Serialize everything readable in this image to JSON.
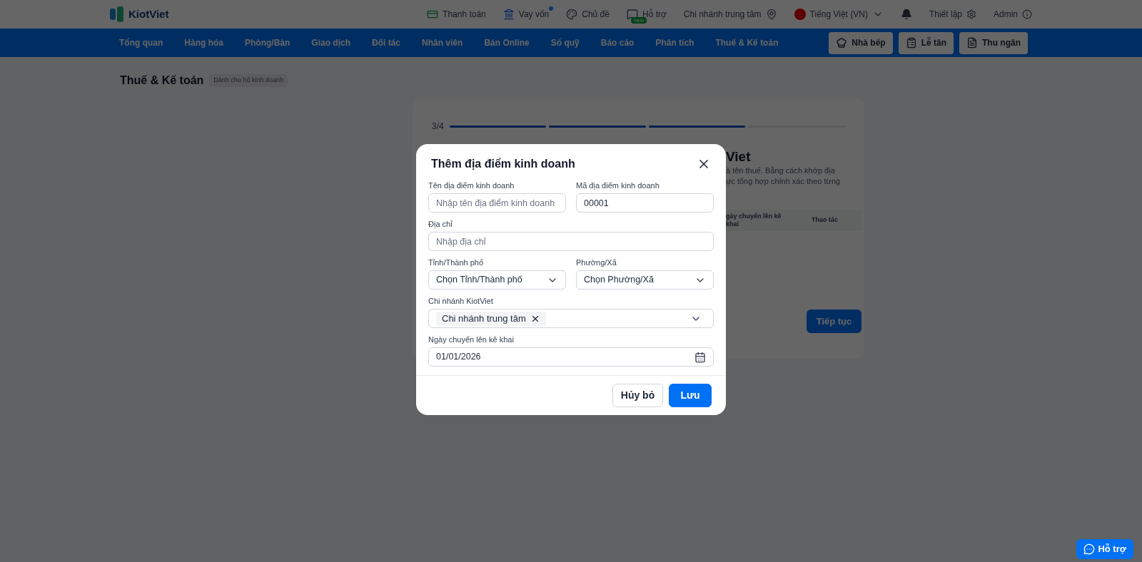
{
  "topbar": {
    "logo": "KiotViet",
    "items": [
      {
        "label": "Thanh toán",
        "kind": "pay"
      },
      {
        "label": "Vay vốn",
        "kind": "loan"
      },
      {
        "label": "Chủ đề",
        "kind": "theme"
      },
      {
        "label": "Hỗ trợ",
        "kind": "support",
        "badge": "New"
      },
      {
        "label": "Chi nhánh trung tâm",
        "kind": "branch"
      },
      {
        "label": "Tiếng Việt (VN)",
        "kind": "lang"
      },
      {
        "kind": "bell"
      },
      {
        "label": "Thiết lập",
        "kind": "settings"
      },
      {
        "label": "Admin",
        "kind": "user"
      }
    ]
  },
  "nav": {
    "items": [
      "Tổng quan",
      "Hàng hóa",
      "Phòng/Bàn",
      "Giao dịch",
      "Đối tác",
      "Nhân viên",
      "Bán Online",
      "Sổ quỹ",
      "Báo cáo",
      "Phân tích",
      "Thuế & Kế toán"
    ],
    "buttons": [
      "Nhà bếp",
      "Lễ tân",
      "Thu ngân"
    ]
  },
  "page": {
    "title": "Thuế & Kế toán",
    "tag": "Dành cho hộ kinh doanh"
  },
  "card": {
    "step": "3/4",
    "steps": [
      {
        "done": true
      },
      {
        "done": true
      },
      {
        "done": true
      },
      {
        "done": false
      }
    ],
    "title_fragment": "Viet",
    "description_fragments": [
      "à tên thuế. Bằng cách khớp địa",
      "ực tổng hợp chính xác theo từng"
    ],
    "columns": [
      "gày chuyển lên kê khai",
      "Thao tác"
    ],
    "next_button": "Tiếp tục"
  },
  "modal": {
    "title": "Thêm địa điểm kinh doanh",
    "rows": [
      [
        {
          "label": "Tên địa điểm kinh doanh",
          "kind": "text",
          "placeholder": "Nhập tên địa điểm kinh doanh"
        },
        {
          "label": "Mã địa điểm kinh doanh",
          "kind": "text",
          "value": "00001"
        }
      ],
      [
        {
          "label": "Địa chỉ",
          "kind": "text",
          "placeholder": "Nhập địa chỉ"
        }
      ],
      [
        {
          "label": "Tỉnh/Thành phố",
          "kind": "select",
          "value": "Chọn Tỉnh/Thành phố"
        },
        {
          "label": "Phường/Xã",
          "kind": "select",
          "value": "Chọn Phường/Xã"
        }
      ],
      [
        {
          "label": "Chi nhánh KiotViet",
          "kind": "tags",
          "tags": [
            "Chi nhánh trung tâm"
          ]
        }
      ],
      [
        {
          "label": "Ngày chuyển lên kê khai",
          "kind": "date",
          "value": "01/01/2026"
        }
      ]
    ],
    "buttons": [
      {
        "label": "Hủy bỏ",
        "kind": "secondary"
      },
      {
        "label": "Lưu",
        "kind": "primary"
      }
    ]
  },
  "help_button": "Hỗ trợ"
}
